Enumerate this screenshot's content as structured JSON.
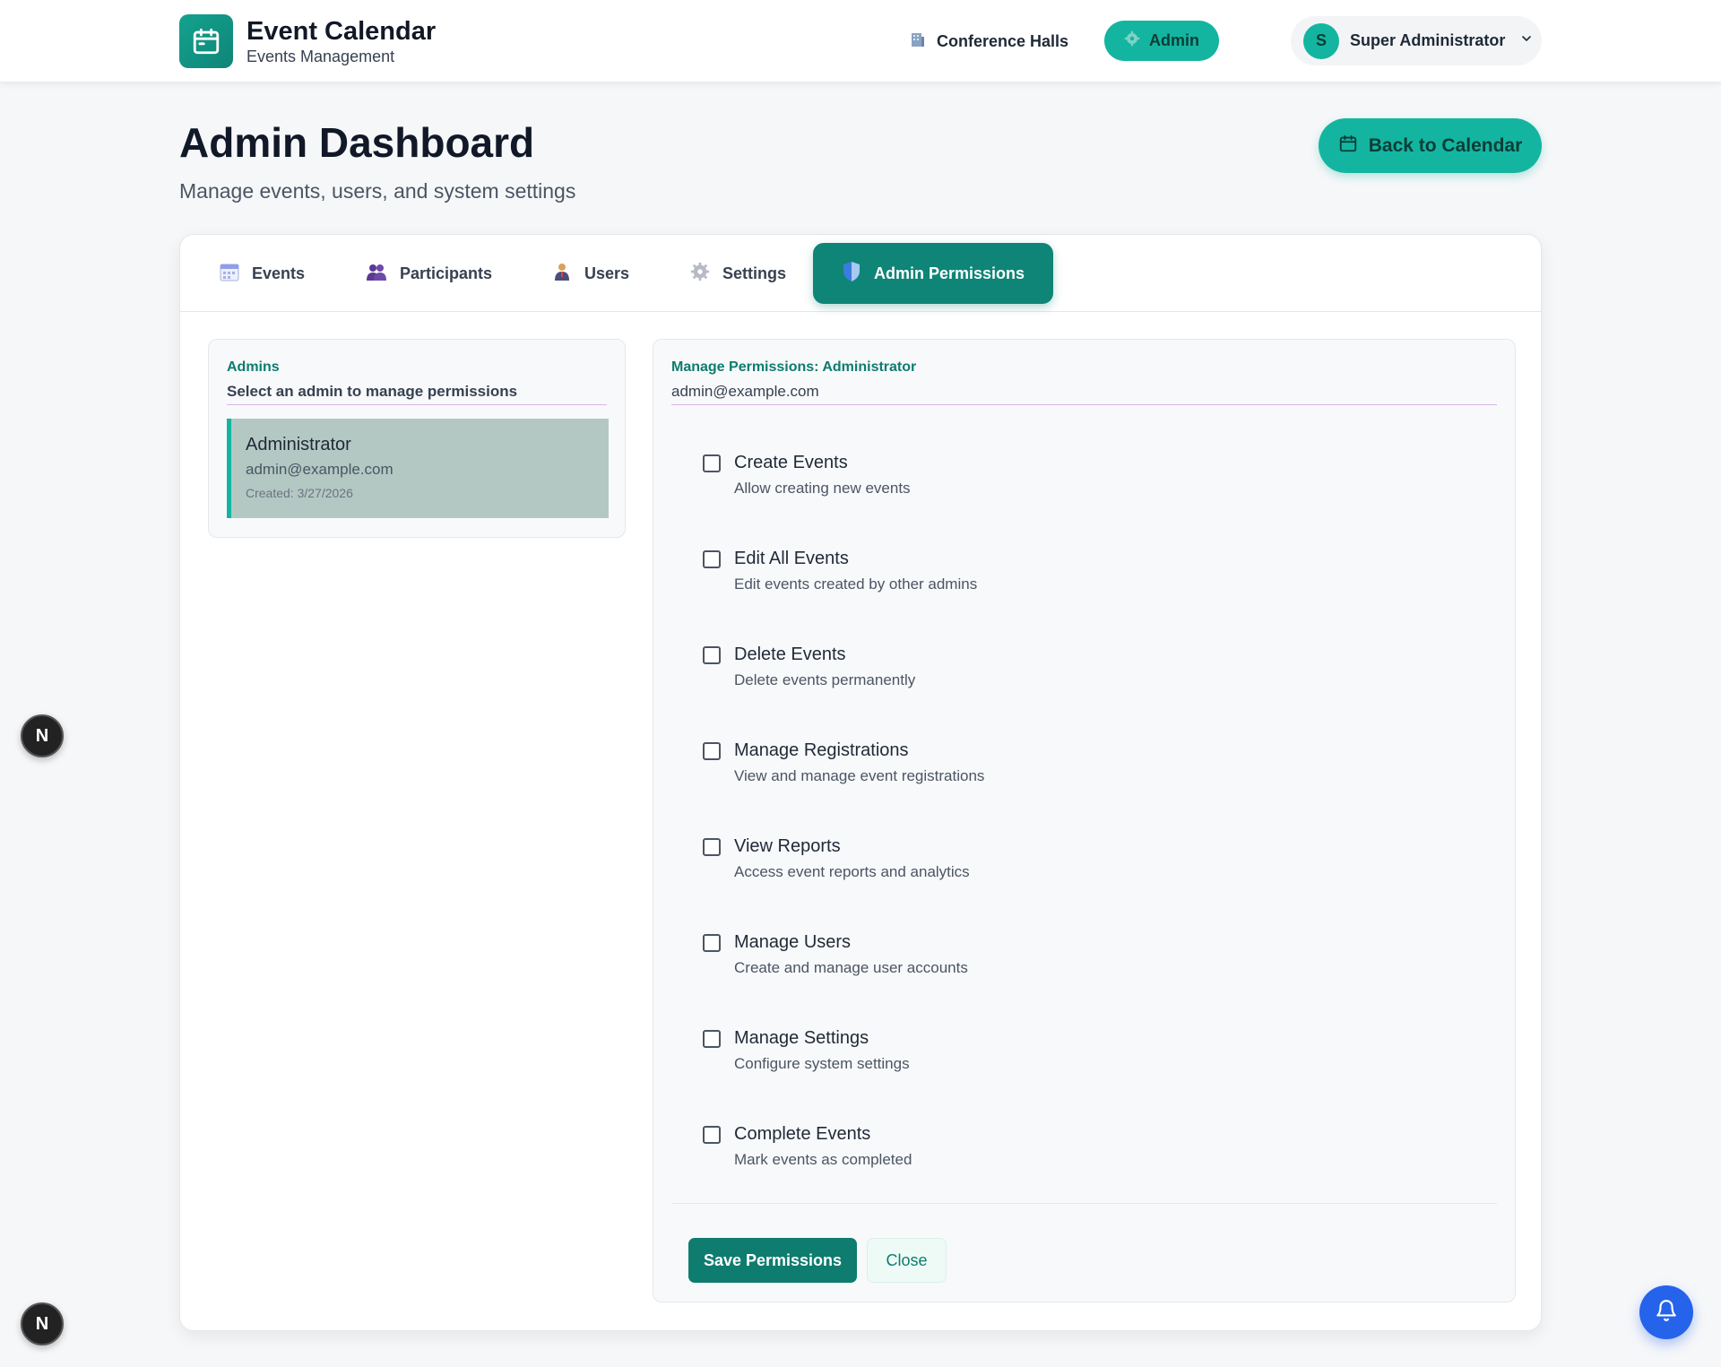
{
  "header": {
    "title": "Event Calendar",
    "subtitle": "Events Management",
    "nav_halls": "Conference Halls",
    "nav_admin": "Admin",
    "user_initial": "S",
    "user_name": "Super Administrator"
  },
  "page": {
    "title": "Admin Dashboard",
    "subtitle": "Manage events, users, and system settings",
    "back_button": "Back to Calendar"
  },
  "tabs": [
    {
      "label": "Events",
      "icon": "calendar-icon"
    },
    {
      "label": "Participants",
      "icon": "people-icon"
    },
    {
      "label": "Users",
      "icon": "user-icon"
    },
    {
      "label": "Settings",
      "icon": "gear-icon"
    },
    {
      "label": "Admin Permissions",
      "icon": "shield-icon",
      "active": true
    }
  ],
  "admins": {
    "title": "Admins",
    "subtitle": "Select an admin to manage permissions",
    "items": [
      {
        "name": "Administrator",
        "email": "admin@example.com",
        "created": "Created: 3/27/2026"
      }
    ]
  },
  "permissions": {
    "title": "Manage Permissions: Administrator",
    "email": "admin@example.com",
    "items": [
      {
        "title": "Create Events",
        "desc": "Allow creating new events"
      },
      {
        "title": "Edit All Events",
        "desc": "Edit events created by other admins"
      },
      {
        "title": "Delete Events",
        "desc": "Delete events permanently"
      },
      {
        "title": "Manage Registrations",
        "desc": "View and manage event registrations"
      },
      {
        "title": "View Reports",
        "desc": "Access event reports and analytics"
      },
      {
        "title": "Manage Users",
        "desc": "Create and manage user accounts"
      },
      {
        "title": "Manage Settings",
        "desc": "Configure system settings"
      },
      {
        "title": "Complete Events",
        "desc": "Mark events as completed"
      }
    ],
    "save_label": "Save Permissions",
    "close_label": "Close"
  },
  "floating": {
    "badge_letter": "N"
  },
  "colors": {
    "accent": "#14b5a0",
    "accent_dark": "#0e7c6f",
    "notify": "#2563eb"
  }
}
